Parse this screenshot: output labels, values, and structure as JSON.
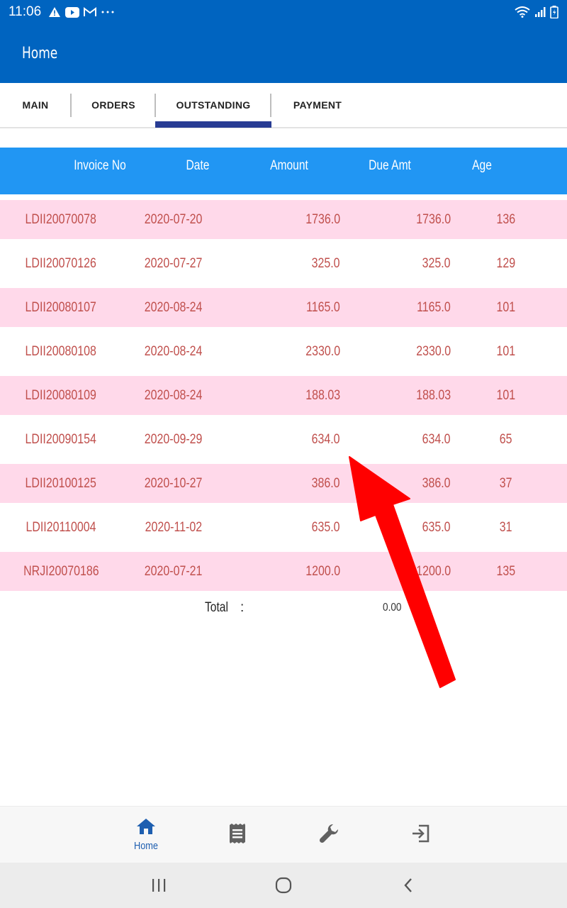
{
  "status_bar": {
    "time": "11:06",
    "icons": [
      "warning-icon",
      "youtube-icon",
      "gmail-icon",
      "more-icon",
      "wifi-icon",
      "signal-icon",
      "battery-icon"
    ]
  },
  "app_bar": {
    "title": "Home"
  },
  "tabs": [
    {
      "label": "MAIN",
      "selected": false
    },
    {
      "label": "ORDERS",
      "selected": false
    },
    {
      "label": "OUTSTANDING",
      "selected": true
    },
    {
      "label": "PAYMENT",
      "selected": false
    }
  ],
  "table": {
    "headers": [
      "Invoice No",
      "Date",
      "Amount",
      "Due Amt",
      "Age"
    ],
    "rows": [
      {
        "invoice": "LDII20070078",
        "date": "2020-07-20",
        "amount": "1736.0",
        "due": "1736.0",
        "age": "136"
      },
      {
        "invoice": "LDII20070126",
        "date": "2020-07-27",
        "amount": "325.0",
        "due": "325.0",
        "age": "129"
      },
      {
        "invoice": "LDII20080107",
        "date": "2020-08-24",
        "amount": "1165.0",
        "due": "1165.0",
        "age": "101"
      },
      {
        "invoice": "LDII20080108",
        "date": "2020-08-24",
        "amount": "2330.0",
        "due": "2330.0",
        "age": "101"
      },
      {
        "invoice": "LDII20080109",
        "date": "2020-08-24",
        "amount": "188.03",
        "due": "188.03",
        "age": "101"
      },
      {
        "invoice": "LDII20090154",
        "date": "2020-09-29",
        "amount": "634.0",
        "due": "634.0",
        "age": "65"
      },
      {
        "invoice": "LDII20100125",
        "date": "2020-10-27",
        "amount": "386.0",
        "due": "386.0",
        "age": "37"
      },
      {
        "invoice": "LDII20110004",
        "date": "2020-11-02",
        "amount": "635.0",
        "due": "635.0",
        "age": "31"
      },
      {
        "invoice": "NRJI20070186",
        "date": "2020-07-21",
        "amount": "1200.0",
        "due": "1200.0",
        "age": "135"
      }
    ]
  },
  "total": {
    "label": "Total",
    "colon": ":",
    "value": "0.00"
  },
  "bottom_nav": [
    {
      "icon": "home-icon",
      "label": "Home",
      "active": true
    },
    {
      "icon": "receipt-icon",
      "label": "",
      "active": false
    },
    {
      "icon": "wrench-icon",
      "label": "",
      "active": false
    },
    {
      "icon": "logout-icon",
      "label": "",
      "active": false
    }
  ],
  "system_nav": [
    "recents-icon",
    "home-circle-icon",
    "back-icon"
  ],
  "colors": {
    "app_bar": "#0064c0",
    "table_header": "#2196f3",
    "row_pink": "#ffd9ea",
    "cell_text": "#c0504d",
    "tab_indicator": "#283c93",
    "annotation_arrow": "#ff0000"
  }
}
